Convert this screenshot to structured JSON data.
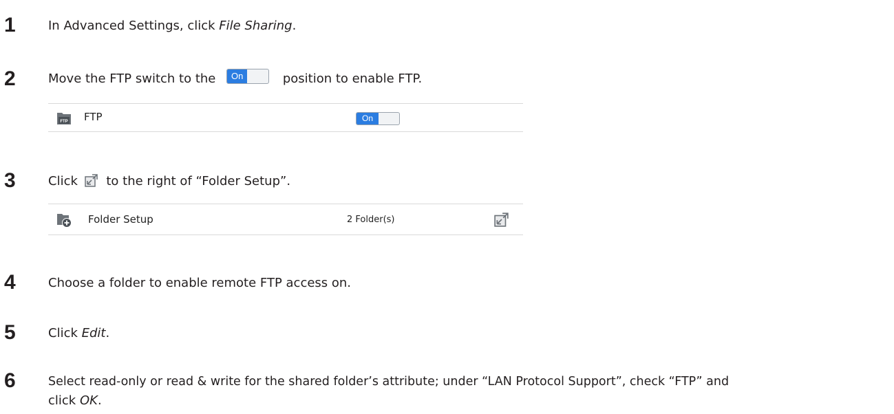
{
  "steps": [
    {
      "number": "1",
      "parts": [
        "In Advanced Settings, click ",
        "File Sharing",
        "."
      ]
    },
    {
      "number": "2",
      "before": "Move the FTP switch to the",
      "after": "position to enable FTP.",
      "switch_label": "On"
    },
    {
      "number": "3",
      "before": "Click",
      "after": "to the right of “Folder Setup”."
    },
    {
      "number": "4",
      "text": "Choose a folder to enable remote FTP access on."
    },
    {
      "number": "5",
      "parts": [
        "Click ",
        "Edit",
        "."
      ]
    },
    {
      "number": "6",
      "line1": "Select read-only or read & write for the shared folder’s attribute; under “LAN Protocol Support”, check “FTP” and",
      "line2_parts": [
        "click ",
        "OK",
        "."
      ]
    }
  ],
  "ftp_panel": {
    "label": "FTP",
    "icon_text": "FTP",
    "switch_label": "On"
  },
  "folder_panel": {
    "label": "Folder Setup",
    "value": "2 Folder(s)"
  },
  "colors": {
    "accent": "#2b7de1",
    "icon_gray": "#6d7379",
    "text": "#231f20"
  }
}
